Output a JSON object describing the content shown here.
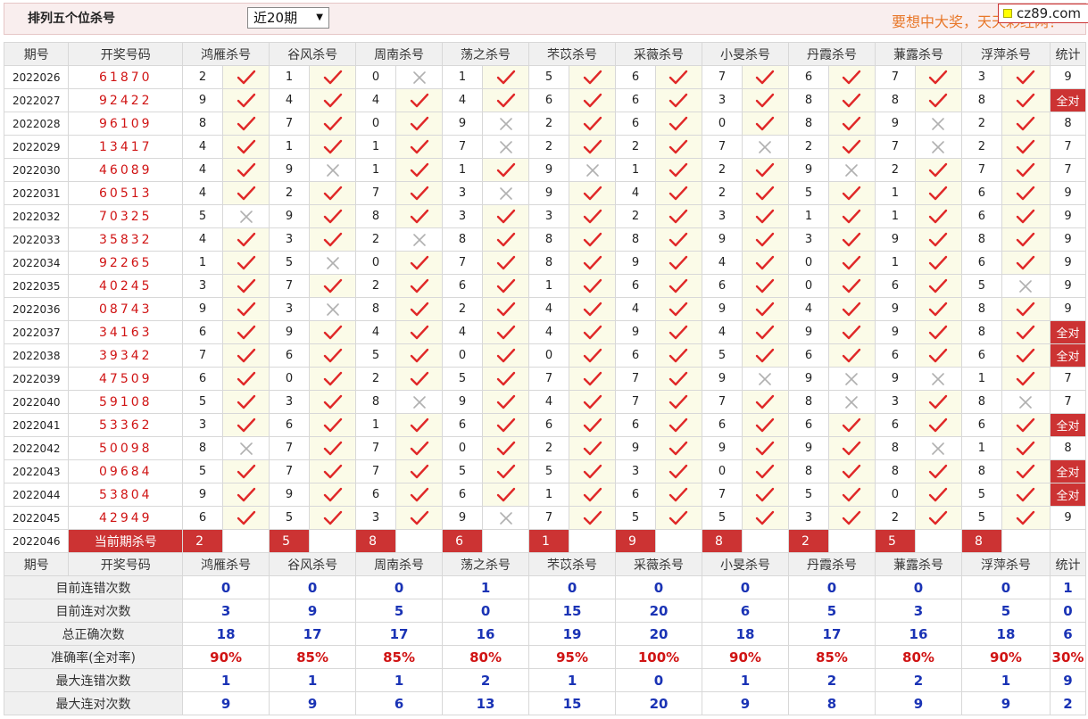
{
  "header": {
    "title": "排列五个位杀号",
    "select_value": "近20期",
    "slogan": "要想中大奖，天天彩经网！",
    "logo": "cz89.com"
  },
  "columns": {
    "period": "期号",
    "draw": "开奖号码",
    "experts": [
      "鸿雁杀号",
      "谷风杀号",
      "周南杀号",
      "荡之杀号",
      "芣苡杀号",
      "采薇杀号",
      "小旻杀号",
      "丹霞杀号",
      "蒹露杀号",
      "浮萍杀号"
    ],
    "stat": "统计"
  },
  "rows": [
    {
      "period": "2022026",
      "draw": "61870",
      "kills": [
        2,
        1,
        0,
        1,
        5,
        6,
        7,
        6,
        7,
        3
      ],
      "hits": [
        1,
        1,
        0,
        1,
        1,
        1,
        1,
        1,
        1,
        1
      ],
      "stat": "9"
    },
    {
      "period": "2022027",
      "draw": "92422",
      "kills": [
        9,
        4,
        4,
        4,
        6,
        6,
        3,
        8,
        8,
        8
      ],
      "hits": [
        1,
        1,
        1,
        1,
        1,
        1,
        1,
        1,
        1,
        1
      ],
      "stat": "全对"
    },
    {
      "period": "2022028",
      "draw": "96109",
      "kills": [
        8,
        7,
        0,
        9,
        2,
        6,
        0,
        8,
        9,
        2
      ],
      "hits": [
        1,
        1,
        1,
        0,
        1,
        1,
        1,
        1,
        0,
        1
      ],
      "stat": "8"
    },
    {
      "period": "2022029",
      "draw": "13417",
      "kills": [
        4,
        1,
        1,
        7,
        2,
        2,
        7,
        2,
        7,
        2
      ],
      "hits": [
        1,
        1,
        1,
        0,
        1,
        1,
        0,
        1,
        0,
        1
      ],
      "stat": "7"
    },
    {
      "period": "2022030",
      "draw": "46089",
      "kills": [
        4,
        9,
        1,
        1,
        9,
        1,
        2,
        9,
        2,
        7
      ],
      "hits": [
        1,
        0,
        1,
        1,
        0,
        1,
        1,
        0,
        1,
        1
      ],
      "stat": "7"
    },
    {
      "period": "2022031",
      "draw": "60513",
      "kills": [
        4,
        2,
        7,
        3,
        9,
        4,
        2,
        5,
        1,
        6
      ],
      "hits": [
        1,
        1,
        1,
        0,
        1,
        1,
        1,
        1,
        1,
        1
      ],
      "stat": "9"
    },
    {
      "period": "2022032",
      "draw": "70325",
      "kills": [
        5,
        9,
        8,
        3,
        3,
        2,
        3,
        1,
        1,
        6
      ],
      "hits": [
        0,
        1,
        1,
        1,
        1,
        1,
        1,
        1,
        1,
        1
      ],
      "stat": "9"
    },
    {
      "period": "2022033",
      "draw": "35832",
      "kills": [
        4,
        3,
        2,
        8,
        8,
        8,
        9,
        3,
        9,
        8
      ],
      "hits": [
        1,
        1,
        0,
        1,
        1,
        1,
        1,
        1,
        1,
        1
      ],
      "stat": "9"
    },
    {
      "period": "2022034",
      "draw": "92265",
      "kills": [
        1,
        5,
        0,
        7,
        8,
        9,
        4,
        0,
        1,
        6
      ],
      "hits": [
        1,
        0,
        1,
        1,
        1,
        1,
        1,
        1,
        1,
        1
      ],
      "stat": "9"
    },
    {
      "period": "2022035",
      "draw": "40245",
      "kills": [
        3,
        7,
        2,
        6,
        1,
        6,
        6,
        0,
        6,
        5
      ],
      "hits": [
        1,
        1,
        1,
        1,
        1,
        1,
        1,
        1,
        1,
        0
      ],
      "stat": "9"
    },
    {
      "period": "2022036",
      "draw": "08743",
      "kills": [
        9,
        3,
        8,
        2,
        4,
        4,
        9,
        4,
        9,
        8
      ],
      "hits": [
        1,
        0,
        1,
        1,
        1,
        1,
        1,
        1,
        1,
        1
      ],
      "stat": "9"
    },
    {
      "period": "2022037",
      "draw": "34163",
      "kills": [
        6,
        9,
        4,
        4,
        4,
        9,
        4,
        9,
        9,
        8
      ],
      "hits": [
        1,
        1,
        1,
        1,
        1,
        1,
        1,
        1,
        1,
        1
      ],
      "stat": "全对"
    },
    {
      "period": "2022038",
      "draw": "39342",
      "kills": [
        7,
        6,
        5,
        0,
        0,
        6,
        5,
        6,
        6,
        6
      ],
      "hits": [
        1,
        1,
        1,
        1,
        1,
        1,
        1,
        1,
        1,
        1
      ],
      "stat": "全对"
    },
    {
      "period": "2022039",
      "draw": "47509",
      "kills": [
        6,
        0,
        2,
        5,
        7,
        7,
        9,
        9,
        9,
        1
      ],
      "hits": [
        1,
        1,
        1,
        1,
        1,
        1,
        0,
        0,
        0,
        1
      ],
      "stat": "7"
    },
    {
      "period": "2022040",
      "draw": "59108",
      "kills": [
        5,
        3,
        8,
        9,
        4,
        7,
        7,
        8,
        3,
        8
      ],
      "hits": [
        1,
        1,
        0,
        1,
        1,
        1,
        1,
        0,
        1,
        0
      ],
      "stat": "7"
    },
    {
      "period": "2022041",
      "draw": "53362",
      "kills": [
        3,
        6,
        1,
        6,
        6,
        6,
        6,
        6,
        6,
        6
      ],
      "hits": [
        1,
        1,
        1,
        1,
        1,
        1,
        1,
        1,
        1,
        1
      ],
      "stat": "全对"
    },
    {
      "period": "2022042",
      "draw": "50098",
      "kills": [
        8,
        7,
        7,
        0,
        2,
        9,
        9,
        9,
        8,
        1
      ],
      "hits": [
        0,
        1,
        1,
        1,
        1,
        1,
        1,
        1,
        0,
        1
      ],
      "stat": "8"
    },
    {
      "period": "2022043",
      "draw": "09684",
      "kills": [
        5,
        7,
        7,
        5,
        5,
        3,
        0,
        8,
        8,
        8
      ],
      "hits": [
        1,
        1,
        1,
        1,
        1,
        1,
        1,
        1,
        1,
        1
      ],
      "stat": "全对"
    },
    {
      "period": "2022044",
      "draw": "53804",
      "kills": [
        9,
        9,
        6,
        6,
        1,
        6,
        7,
        5,
        0,
        5
      ],
      "hits": [
        1,
        1,
        1,
        1,
        1,
        1,
        1,
        1,
        1,
        1
      ],
      "stat": "全对"
    },
    {
      "period": "2022045",
      "draw": "42949",
      "kills": [
        6,
        5,
        3,
        9,
        7,
        5,
        5,
        3,
        2,
        5
      ],
      "hits": [
        1,
        1,
        1,
        0,
        1,
        1,
        1,
        1,
        1,
        1
      ],
      "stat": "9"
    }
  ],
  "current": {
    "period": "2022046",
    "label": "当前期杀号",
    "kills": [
      2,
      5,
      8,
      6,
      1,
      9,
      8,
      2,
      5,
      8
    ]
  },
  "summary": [
    {
      "label": "目前连错次数",
      "values": [
        "0",
        "0",
        "0",
        "1",
        "0",
        "0",
        "0",
        "0",
        "0",
        "0"
      ],
      "stat": "1"
    },
    {
      "label": "目前连对次数",
      "values": [
        "3",
        "9",
        "5",
        "0",
        "15",
        "20",
        "6",
        "5",
        "3",
        "5"
      ],
      "stat": "0"
    },
    {
      "label": "总正确次数",
      "values": [
        "18",
        "17",
        "17",
        "16",
        "19",
        "20",
        "18",
        "17",
        "16",
        "18"
      ],
      "stat": "6"
    },
    {
      "label": "准确率(全对率)",
      "values": [
        "90%",
        "85%",
        "85%",
        "80%",
        "95%",
        "100%",
        "90%",
        "85%",
        "80%",
        "90%"
      ],
      "stat": "30%"
    },
    {
      "label": "最大连错次数",
      "values": [
        "1",
        "1",
        "1",
        "2",
        "1",
        "0",
        "1",
        "2",
        "2",
        "1"
      ],
      "stat": "9"
    },
    {
      "label": "最大连对次数",
      "values": [
        "9",
        "9",
        "6",
        "13",
        "15",
        "20",
        "9",
        "8",
        "9",
        "9"
      ],
      "stat": "2"
    }
  ],
  "colors": {
    "accent": "#cc3333",
    "check": "#e02828",
    "cross": "#b0b0b0",
    "summary_value": "#1a33b5",
    "rate": "#d01414",
    "slogan": "#e8782a"
  }
}
